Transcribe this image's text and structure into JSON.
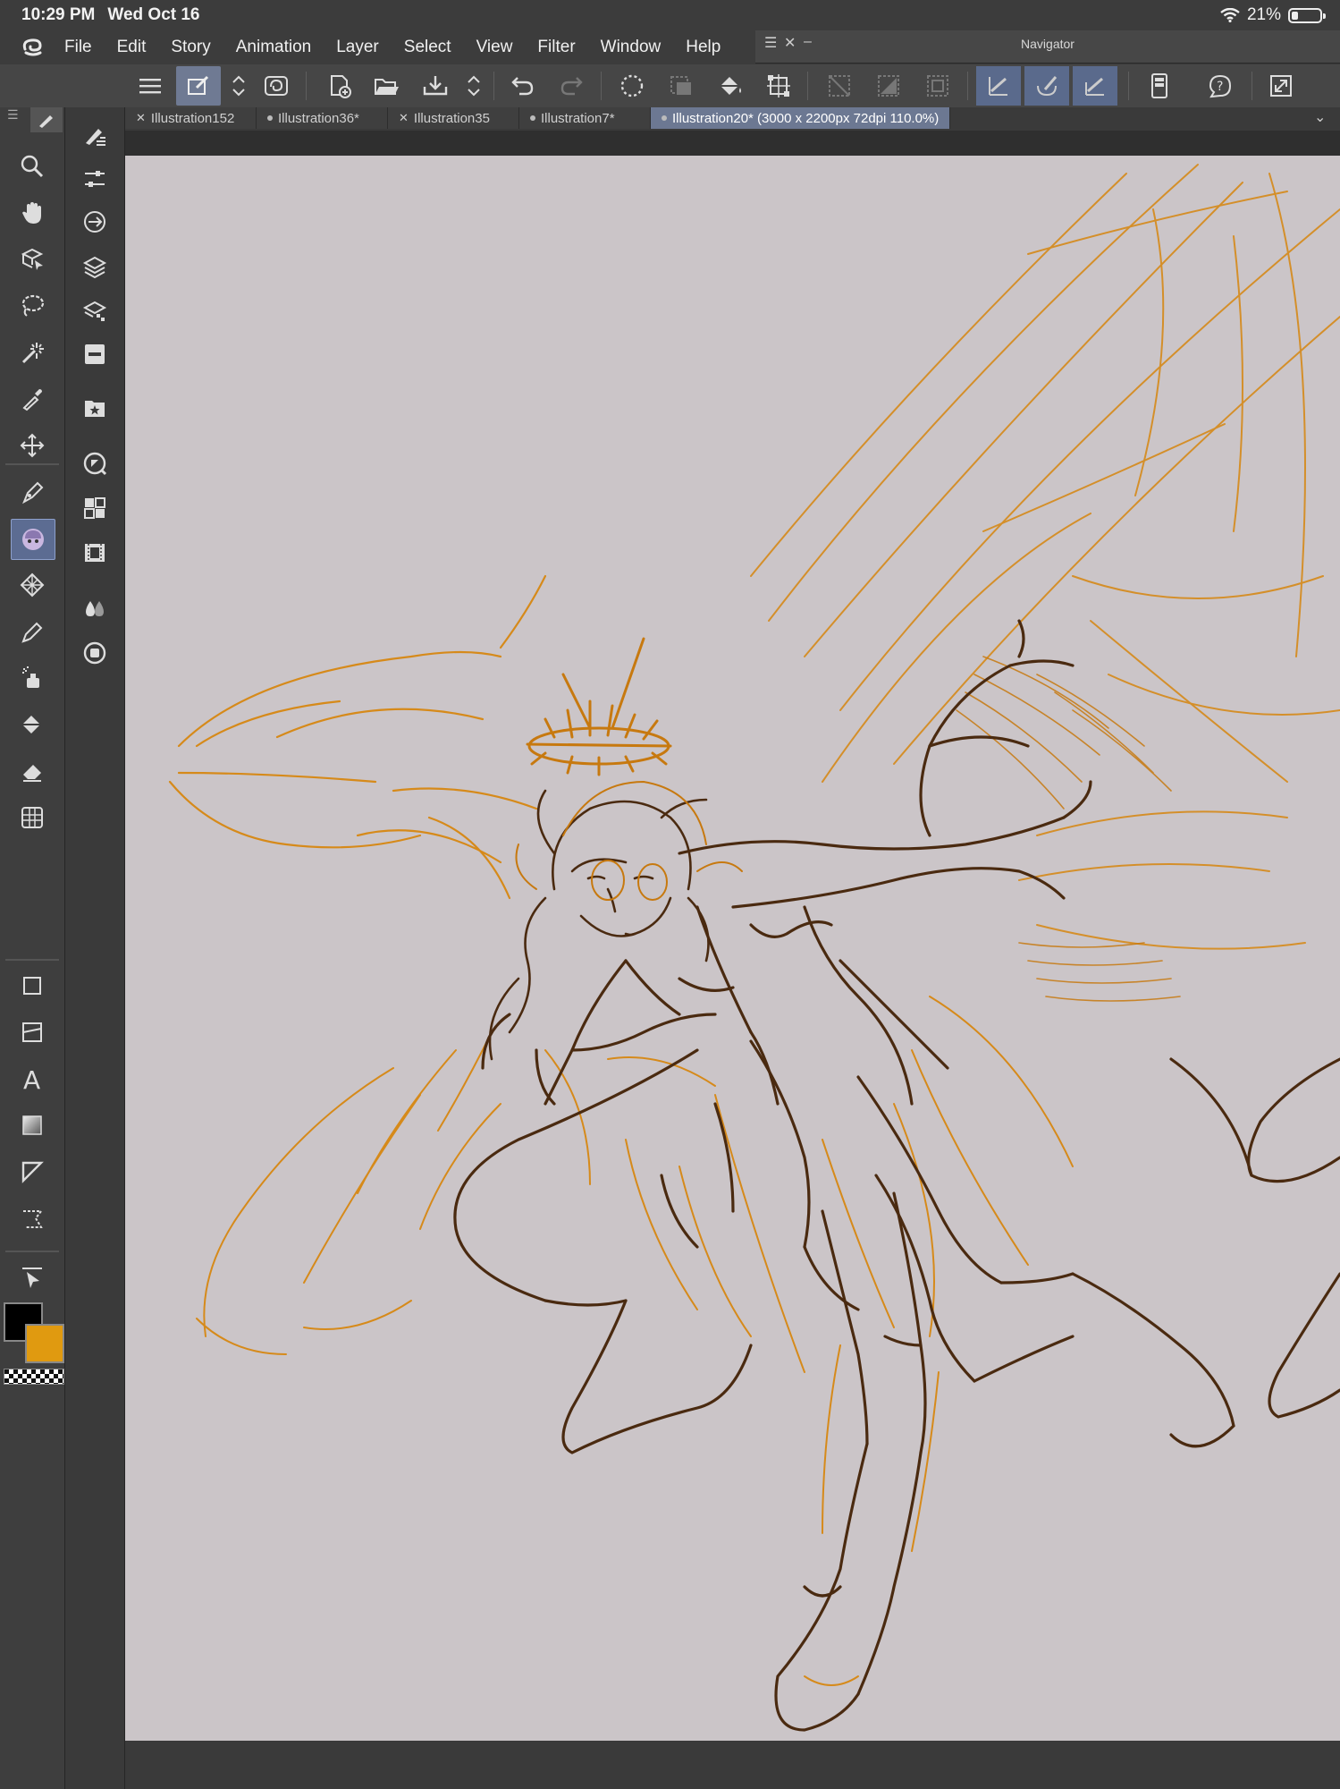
{
  "status_bar": {
    "time": "10:29 PM",
    "date": "Wed Oct 16",
    "battery_percent": "21%",
    "battery_level": 0.21,
    "wifi_icon": "wifi-icon"
  },
  "menu": {
    "items": [
      "File",
      "Edit",
      "Story",
      "Animation",
      "Layer",
      "Select",
      "View",
      "Filter",
      "Window",
      "Help"
    ]
  },
  "navigator": {
    "title": "Navigator"
  },
  "tabs": [
    {
      "label": "Illustration152",
      "marker": "close"
    },
    {
      "label": "Illustration36*",
      "marker": "dot"
    },
    {
      "label": "Illustration35",
      "marker": "close"
    },
    {
      "label": "Illustration7*",
      "marker": "dot"
    },
    {
      "label": "Illustration20* (3000 x 2200px 72dpi 110.0%)",
      "marker": "dot",
      "active": true
    }
  ],
  "colors": {
    "main_color": "#000000",
    "sub_color": "#e09a10",
    "accent": "#6c7892",
    "canvas": "#cbc5c8"
  },
  "toolbar_icons": [
    "menu-icon",
    "layer-property-icon",
    "updown-icon",
    "lasso-fill-icon",
    "new-file-icon",
    "open-file-icon",
    "save-icon",
    "updown-icon",
    "undo-icon",
    "redo-icon",
    "deselect-icon",
    "clear-icon",
    "fill-icon",
    "transform-icon",
    "hide-selection-icon",
    "snap-ruler-icon",
    "snap-grid-icon",
    "pen-pressure-icon",
    "brush-icon",
    "stabilizer-icon",
    "device-icon",
    "help-icon",
    "fullscreen-icon"
  ],
  "tools": [
    "zoom-icon",
    "hand-icon",
    "operation-icon",
    "lasso-icon",
    "magic-wand-icon",
    "eyedropper-icon",
    "move-icon",
    "pen-icon",
    "brush-tool-icon",
    "decoration-icon",
    "pen-alt-icon",
    "airbrush-icon",
    "fill-bucket-icon",
    "eraser-icon",
    "blend-icon",
    "figure-icon",
    "frame-icon",
    "text-icon",
    "gradient-icon",
    "ruler-icon",
    "balloon-icon",
    "selector-icon"
  ],
  "palettes": [
    "tool-property-icon",
    "sub-tool-icon",
    "color-slider-icon",
    "layer-icon",
    "layer-property-palette-icon",
    "layer-search-icon",
    "material-icon",
    "navigator-icon",
    "item-bank-icon",
    "timeline-icon",
    "color-set-icon",
    "history-icon"
  ]
}
